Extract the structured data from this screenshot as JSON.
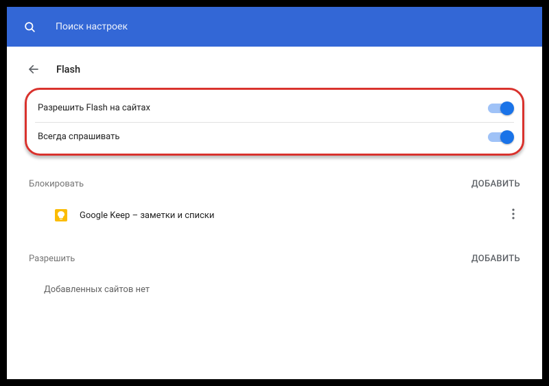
{
  "search": {
    "placeholder": "Поиск настроек"
  },
  "page": {
    "title": "Flash"
  },
  "toggles": {
    "allow_flash": {
      "label": "Разрешить Flash на сайтах",
      "enabled": true
    },
    "always_ask": {
      "label": "Всегда спрашивать",
      "enabled": true
    }
  },
  "sections": {
    "block": {
      "label": "Блокировать",
      "add_label": "ДОБАВИТЬ",
      "items": [
        {
          "name": "Google Keep – заметки и списки",
          "icon": "keep-icon"
        }
      ]
    },
    "allow": {
      "label": "Разрешить",
      "add_label": "ДОБАВИТЬ",
      "empty_msg": "Добавленных сайтов нет"
    }
  }
}
